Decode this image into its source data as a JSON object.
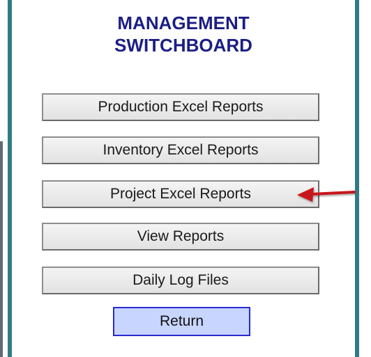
{
  "switchboard": {
    "title_line1": "MANAGEMENT",
    "title_line2": "SWITCHBOARD",
    "buttons": [
      {
        "label": "Production Excel Reports"
      },
      {
        "label": "Inventory Excel Reports"
      },
      {
        "label": "Project Excel Reports"
      },
      {
        "label": "View Reports"
      },
      {
        "label": "Daily Log Files"
      }
    ],
    "return_label": "Return"
  },
  "colors": {
    "title": "#1c1e84",
    "border": "#2f7c86",
    "arrow": "#c8141e",
    "return_fill": "#c8d5ff"
  },
  "annotation": {
    "arrow_icon": "red-arrow-left-icon"
  }
}
